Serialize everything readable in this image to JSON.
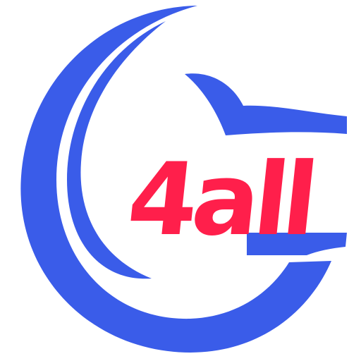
{
  "logo": {
    "wordmark": "4all",
    "colors": {
      "ring": "#3a5ce9",
      "text": "#ff1f4b",
      "background": "#ffffff"
    }
  }
}
